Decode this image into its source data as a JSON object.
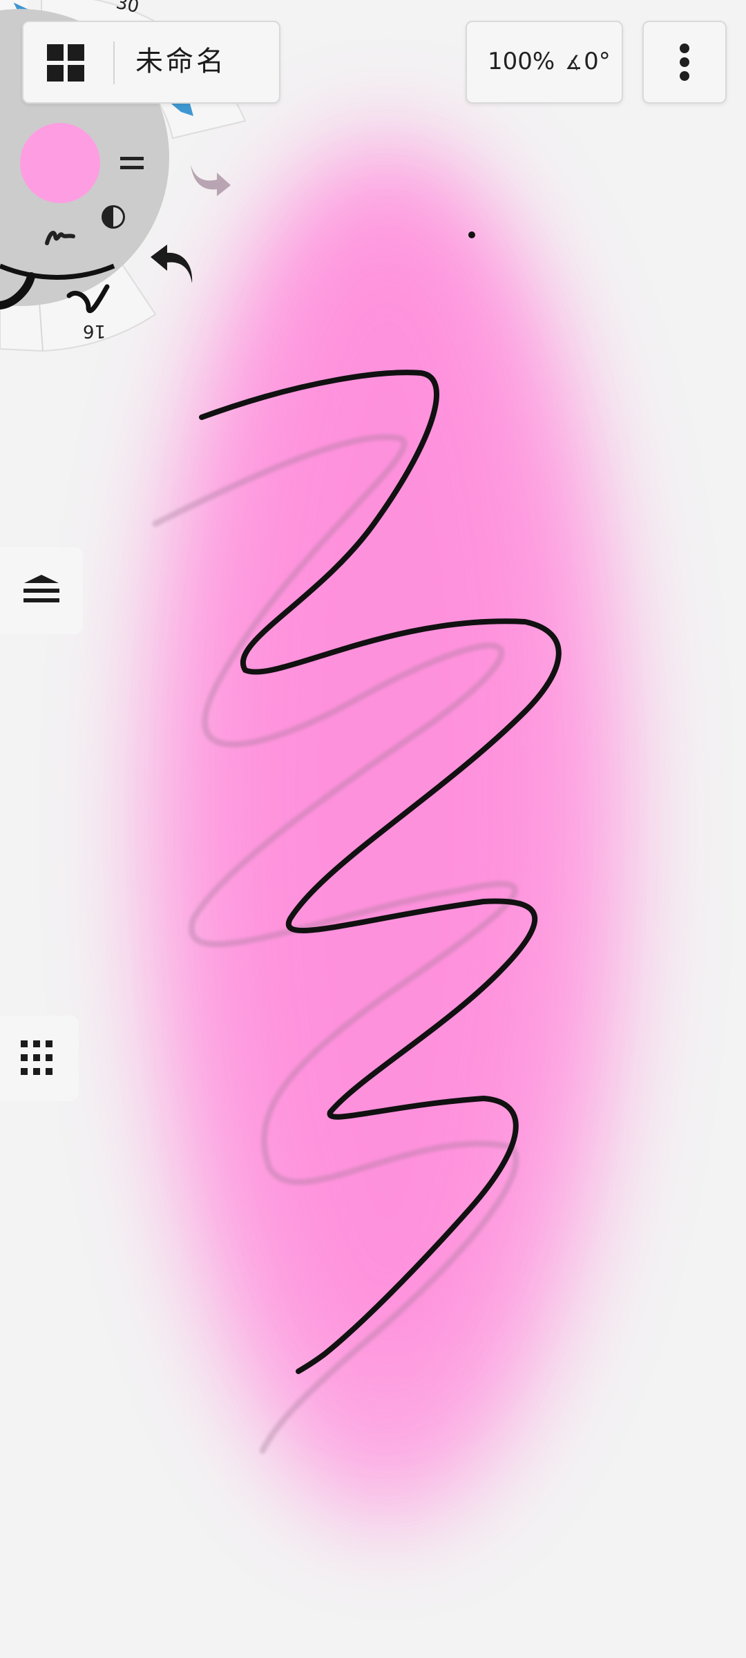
{
  "toolbar": {
    "title": "未命名",
    "zoom": "100%",
    "angle": "0°",
    "angle_icon": "∡"
  },
  "brush_wheel": {
    "color": "#ff9de2",
    "top_size_label": "30",
    "bottom_size_label": "16"
  },
  "canvas": {
    "background": "#f3f3f3",
    "airbrush_color": "#ff92de",
    "stroke_color": "#111111"
  },
  "icons": {
    "gallery": "gallery-grid-icon",
    "menu": "more-vertical-icon",
    "undo": "undo-arrow-icon",
    "redo": "redo-arrow-icon",
    "layers": "layers-icon",
    "grid": "dot-grid-icon",
    "opacity": "contrast-icon",
    "brush_settings": "equals-icon",
    "brush_type": "brush-stroke-icon"
  }
}
